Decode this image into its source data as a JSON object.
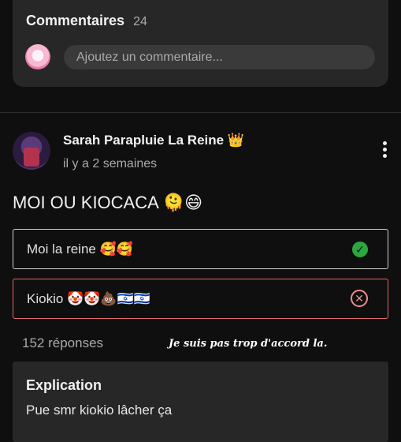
{
  "comments": {
    "title": "Commentaires",
    "count": "24",
    "placeholder": "Ajoutez un commentaire..."
  },
  "post": {
    "author": "Sarah Parapluie La Reine 👑",
    "time": "il y a 2 semaines",
    "question": "MOI OU KIOCACA 🫠😄"
  },
  "poll": {
    "options": [
      {
        "label": "Moi la reine 🥰🥰",
        "state": "correct"
      },
      {
        "label": "Kiokio 🤡🤡💩🇮🇱🇮🇱",
        "state": "wrong"
      }
    ],
    "responses": "152 réponses"
  },
  "overlay_note": "Je suis pas trop d'accord la.",
  "explanation": {
    "title": "Explication",
    "text": "Pue smr kiokio lâcher ça"
  },
  "colors": {
    "background": "#0f0f0f",
    "card": "#272727",
    "correct": "#2ba640",
    "wrong": "#e06a6a"
  }
}
